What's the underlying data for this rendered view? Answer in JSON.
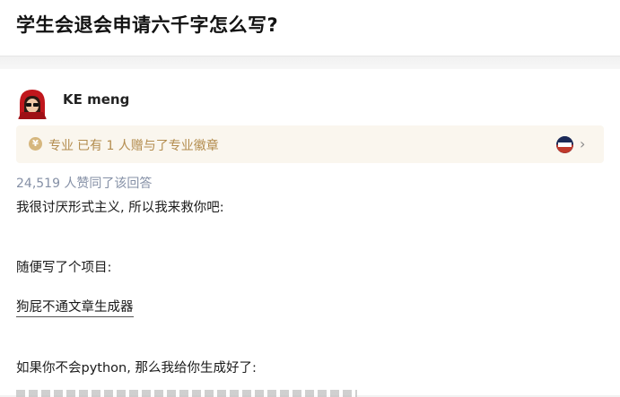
{
  "question": {
    "title": "学生会退会申请六千字怎么写?"
  },
  "answer": {
    "author": "KE meng",
    "badge": {
      "label": "专业",
      "description": "已有 1 人赠与了专业徽章",
      "icon": "coin-icon",
      "color": "#b38c4e"
    },
    "votes": "24,519 人赞同了该回答",
    "paragraphs": [
      "我很讨厌形式主义, 所以我来救你吧:",
      "随便写了个项目:",
      "如果你不会python, 那么我给你生成好了:"
    ],
    "link_text": "狗屁不通文章生成器"
  }
}
